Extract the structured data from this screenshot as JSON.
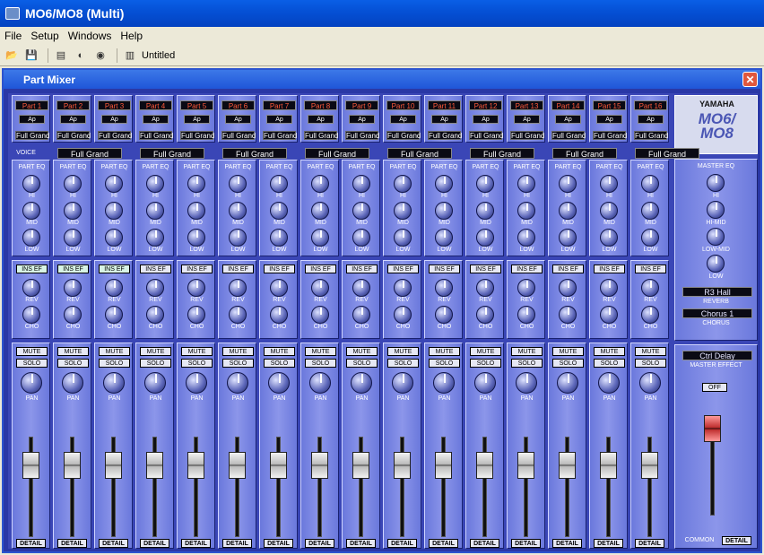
{
  "app": {
    "title": "MO6/MO8 (Multi)"
  },
  "menu": {
    "items": [
      "File",
      "Setup",
      "Windows",
      "Help"
    ]
  },
  "toolbar": {
    "document_name": "Untitled"
  },
  "window": {
    "title": "Part Mixer",
    "close": "✕"
  },
  "labels": {
    "voice": "VOICE",
    "part_eq": "PART EQ",
    "hi": "HI",
    "mid": "MID",
    "low": "LOW",
    "ins_ef": "INS EF",
    "rev": "REV",
    "cho": "CHO",
    "mute": "MUTE",
    "solo": "SOLO",
    "pan": "PAN",
    "detail": "DETAIL"
  },
  "parts": [
    {
      "name": "Part 1",
      "ap": "Ap",
      "voice": "Full Grand",
      "ins_active": true
    },
    {
      "name": "Part 2",
      "ap": "Ap",
      "voice": "Full Grand",
      "ins_active": true
    },
    {
      "name": "Part 3",
      "ap": "Ap",
      "voice": "Full Grand",
      "ins_active": true
    },
    {
      "name": "Part 4",
      "ap": "Ap",
      "voice": "Full Grand",
      "ins_active": false
    },
    {
      "name": "Part 5",
      "ap": "Ap",
      "voice": "Full Grand",
      "ins_active": false
    },
    {
      "name": "Part 6",
      "ap": "Ap",
      "voice": "Full Grand",
      "ins_active": false
    },
    {
      "name": "Part 7",
      "ap": "Ap",
      "voice": "Full Grand",
      "ins_active": false
    },
    {
      "name": "Part 8",
      "ap": "Ap",
      "voice": "Full Grand",
      "ins_active": false
    },
    {
      "name": "Part 9",
      "ap": "Ap",
      "voice": "Full Grand",
      "ins_active": false
    },
    {
      "name": "Part 10",
      "ap": "Ap",
      "voice": "Full Grand",
      "ins_active": false
    },
    {
      "name": "Part 11",
      "ap": "Ap",
      "voice": "Full Grand",
      "ins_active": false
    },
    {
      "name": "Part 12",
      "ap": "Ap",
      "voice": "Full Grand",
      "ins_active": false
    },
    {
      "name": "Part 13",
      "ap": "Ap",
      "voice": "Full Grand",
      "ins_active": false
    },
    {
      "name": "Part 14",
      "ap": "Ap",
      "voice": "Full Grand",
      "ins_active": false
    },
    {
      "name": "Part 15",
      "ap": "Ap",
      "voice": "Full Grand",
      "ins_active": false
    },
    {
      "name": "Part 16",
      "ap": "Ap",
      "voice": "Full Grand",
      "ins_active": false
    }
  ],
  "voice_row": [
    "Full Grand",
    "Full Grand",
    "Full Grand",
    "Full Grand",
    "Full Grand",
    "Full Grand",
    "Full Grand",
    "Full Grand"
  ],
  "common": {
    "brand": "YAMAHA",
    "model": "MO6/\nMO8",
    "master_eq": "MASTER EQ",
    "hi": "HI",
    "hi_mid": "HI-MID",
    "low_mid": "LOW-MID",
    "low": "LOW",
    "reverb_value": "R3 Hall",
    "reverb_label": "REVERB",
    "chorus_value": "Chorus 1",
    "chorus_label": "CHORUS",
    "master_effect_value": "Ctrl Delay",
    "master_effect_label": "MASTER EFFECT",
    "master_effect_state": "OFF",
    "common_label": "COMMON",
    "detail": "DETAIL"
  },
  "colors": {
    "accent": "#3a46b6",
    "part_text": "#ff5a3a",
    "fader_cap_common": "#c03030"
  }
}
